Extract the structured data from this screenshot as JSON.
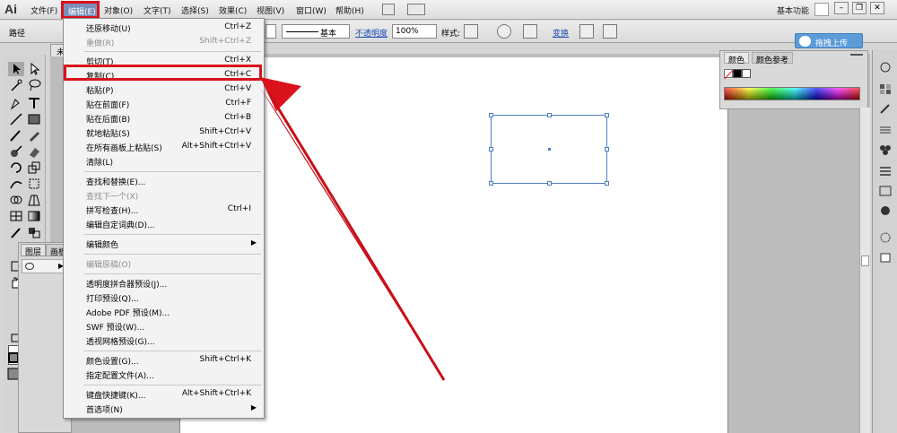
{
  "app": {
    "logo": "Ai"
  },
  "menubar": {
    "items": [
      "文件(F)",
      "编辑(E)",
      "对象(O)",
      "文字(T)",
      "选择(S)",
      "效果(C)",
      "视图(V)",
      "窗口(W)",
      "帮助(H)"
    ],
    "workspace": "基本功能"
  },
  "window_controls": {
    "minimize": "–",
    "restore": "❐",
    "close": "✕"
  },
  "controlbar": {
    "path_label": "路径",
    "stroke_style": "基本",
    "opacity_label": "不透明度",
    "opacity_value": "100%",
    "style_label": "样式:",
    "transform_label": "变换"
  },
  "upload_button": "拖拽上传",
  "doc_tab": "未",
  "layers_panel": {
    "tab_layers": "图层",
    "tab_artboards": "画板"
  },
  "color_panel": {
    "tab_color": "颜色",
    "tab_guide": "颜色参考"
  },
  "edit_menu": {
    "items": [
      {
        "label": "还原移动(U)",
        "shortcut": "Ctrl+Z",
        "disabled": false
      },
      {
        "label": "重做(R)",
        "shortcut": "Shift+Ctrl+Z",
        "disabled": true
      },
      {
        "label": "剪切(T)",
        "shortcut": "Ctrl+X",
        "disabled": false
      },
      {
        "label": "复制(C)",
        "shortcut": "Ctrl+C",
        "disabled": false
      },
      {
        "label": "粘贴(P)",
        "shortcut": "Ctrl+V",
        "disabled": false
      },
      {
        "label": "贴在前面(F)",
        "shortcut": "Ctrl+F",
        "disabled": false
      },
      {
        "label": "贴在后面(B)",
        "shortcut": "Ctrl+B",
        "disabled": false
      },
      {
        "label": "就地粘贴(S)",
        "shortcut": "Shift+Ctrl+V",
        "disabled": false
      },
      {
        "label": "在所有画板上粘贴(S)",
        "shortcut": "Alt+Shift+Ctrl+V",
        "disabled": false
      },
      {
        "label": "清除(L)",
        "shortcut": "",
        "disabled": false
      },
      {
        "label": "查找和替换(E)...",
        "shortcut": "",
        "disabled": false
      },
      {
        "label": "查找下一个(X)",
        "shortcut": "",
        "disabled": true
      },
      {
        "label": "拼写检查(H)...",
        "shortcut": "Ctrl+I",
        "disabled": false
      },
      {
        "label": "编辑自定词典(D)...",
        "shortcut": "",
        "disabled": false
      },
      {
        "label": "编辑颜色",
        "shortcut": "",
        "disabled": false
      },
      {
        "label": "编辑原稿(O)",
        "shortcut": "",
        "disabled": true
      },
      {
        "label": "透明度拼合器预设(J)...",
        "shortcut": "",
        "disabled": false
      },
      {
        "label": "打印预设(Q)...",
        "shortcut": "",
        "disabled": false
      },
      {
        "label": "Adobe PDF 预设(M)...",
        "shortcut": "",
        "disabled": false
      },
      {
        "label": "SWF 预设(W)...",
        "shortcut": "",
        "disabled": false
      },
      {
        "label": "透视网格预设(G)...",
        "shortcut": "",
        "disabled": false
      },
      {
        "label": "颜色设置(G)...",
        "shortcut": "Shift+Ctrl+K",
        "disabled": false
      },
      {
        "label": "指定配置文件(A)...",
        "shortcut": "",
        "disabled": false
      },
      {
        "label": "键盘快捷键(K)...",
        "shortcut": "Alt+Shift+Ctrl+K",
        "disabled": false
      },
      {
        "label": "首选项(N)",
        "shortcut": "",
        "disabled": false
      }
    ]
  },
  "colors": {
    "highlight_red": "#d9121c",
    "selection_blue": "#4c7fc5",
    "menu_active": "#7a8fb8"
  }
}
